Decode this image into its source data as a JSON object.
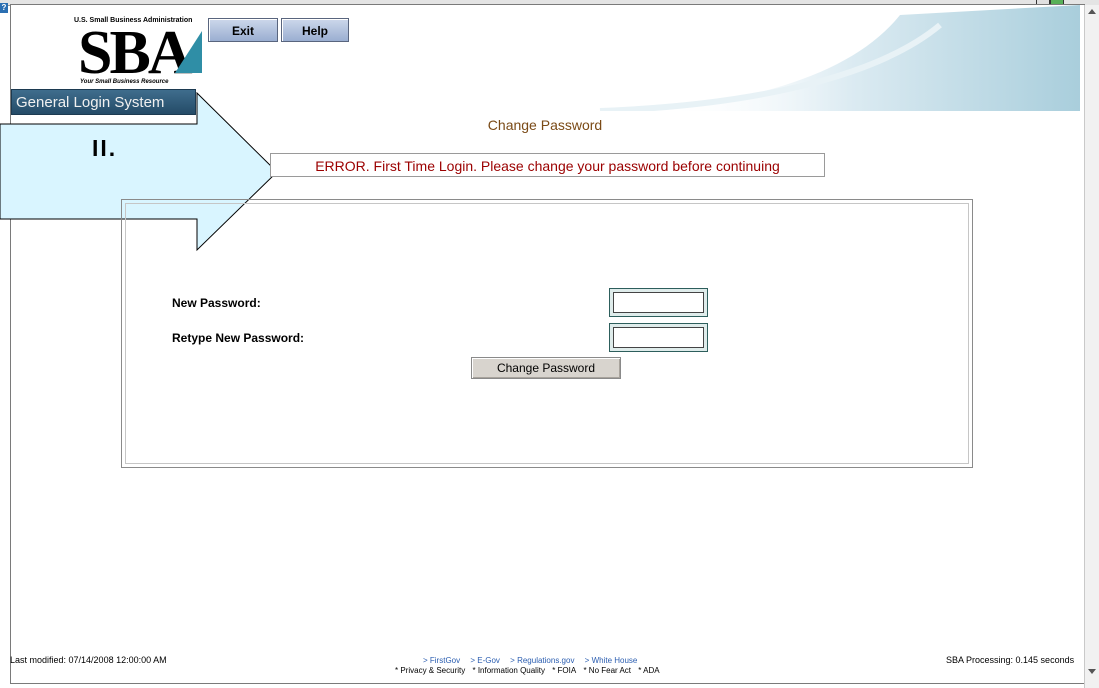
{
  "colors": {
    "accent_bar": "#2f5c7c",
    "error_text": "#9b0000",
    "heading_text": "#7a4a16",
    "arrow_fill": "#d9f5ff",
    "toolbar_button": "#b5c3e0"
  },
  "window": {
    "help_icon": "question-icon"
  },
  "logo": {
    "agency_text": "U.S. Small Business Administration",
    "letters": "SBA",
    "tagline": "Your Small Business Resource"
  },
  "header": {
    "system_title": "General Login System",
    "exit_label": "Exit",
    "help_label": "Help"
  },
  "annotation": {
    "step_label": "II."
  },
  "page": {
    "heading": "Change Password",
    "error_message": "ERROR. First Time Login. Please change your password before continuing"
  },
  "form": {
    "new_password_label": "New Password:",
    "new_password_value": "",
    "retype_password_label": "Retype New Password:",
    "retype_password_value": "",
    "submit_label": "Change Password"
  },
  "footer": {
    "last_modified": "Last modified: 07/14/2008 12:00:00 AM",
    "processing": "SBA Processing:  0.145 seconds",
    "links": [
      "> FirstGov",
      "> E-Gov",
      "> Regulations.gov",
      "> White House"
    ],
    "policies": [
      "* Privacy & Security",
      "* Information Quality",
      "* FOIA",
      "* No Fear Act",
      "* ADA"
    ]
  }
}
